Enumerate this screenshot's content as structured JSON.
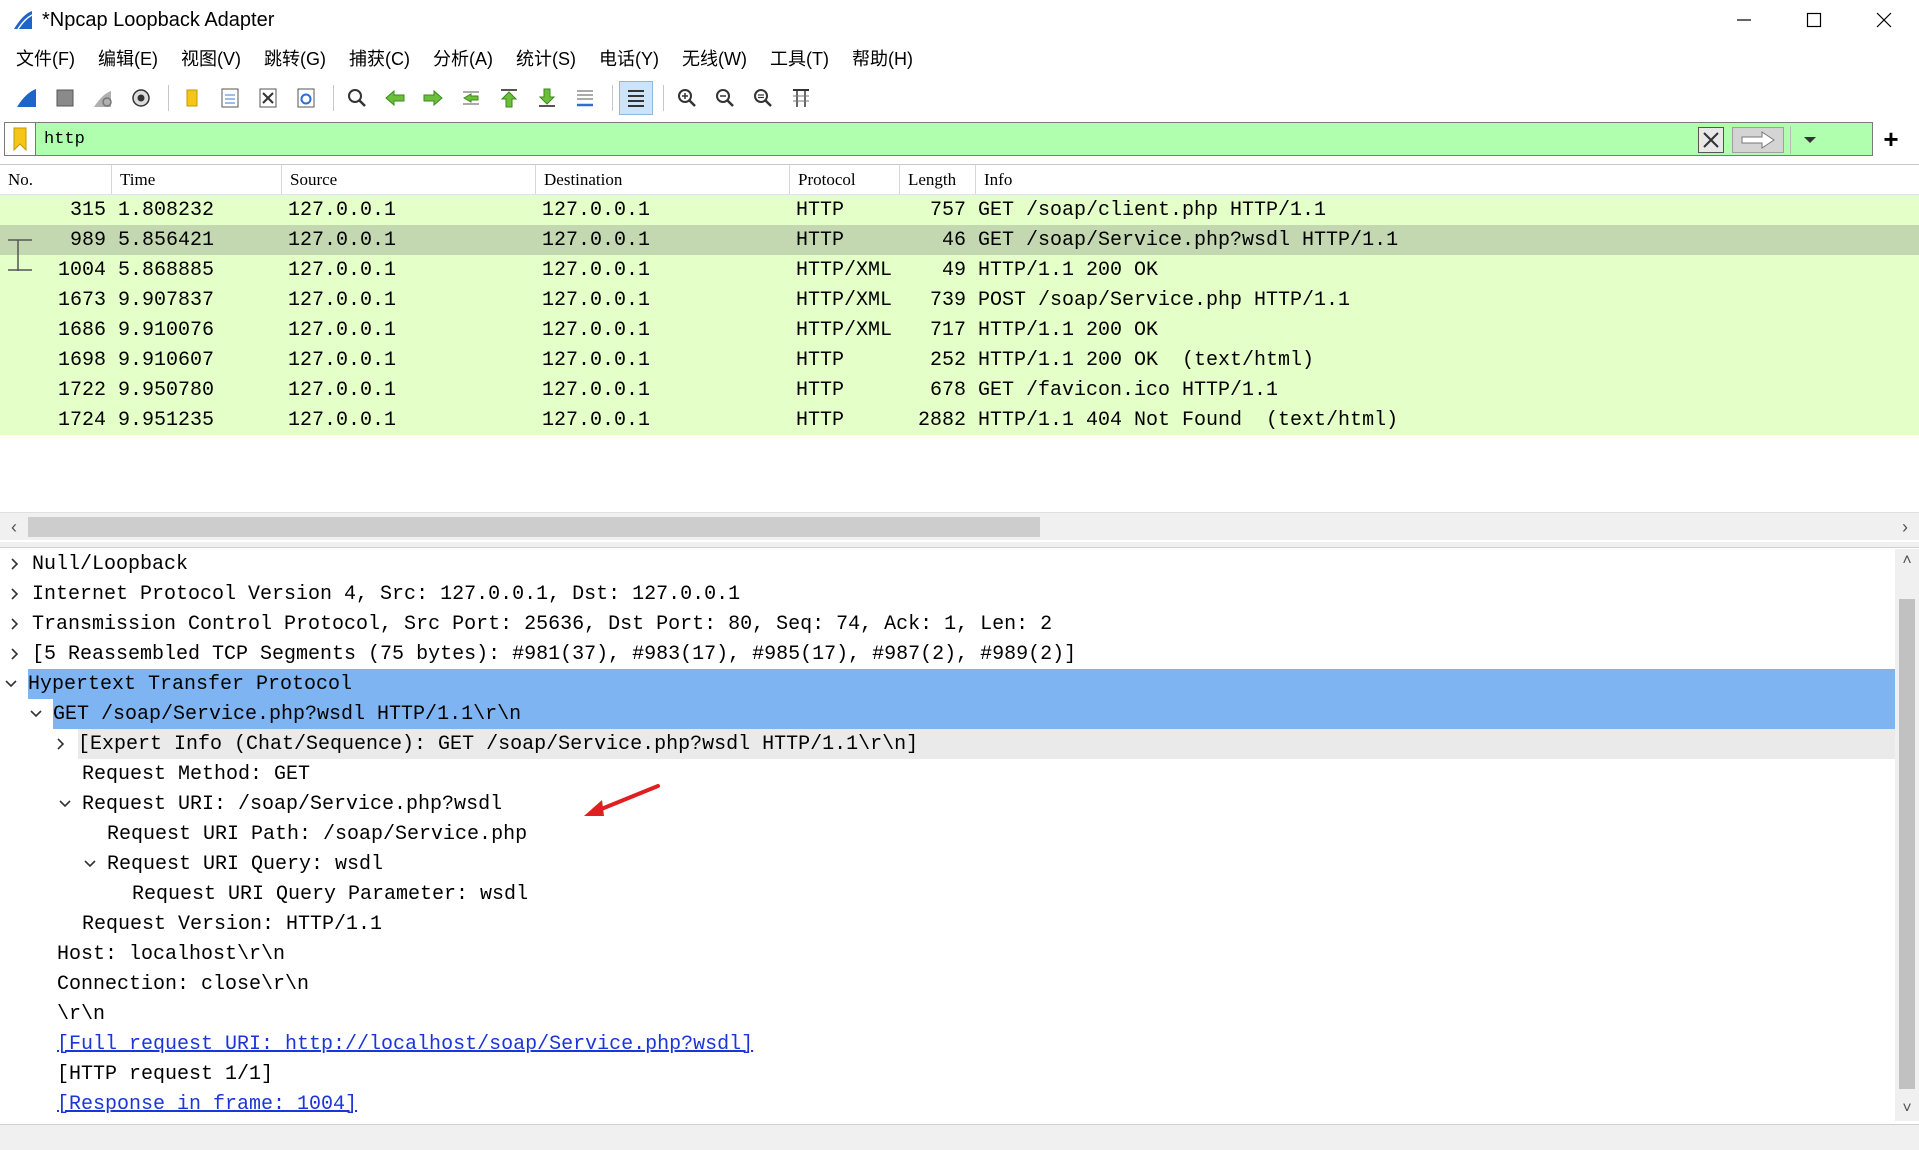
{
  "window": {
    "title": "*Npcap Loopback Adapter",
    "minimize": "—",
    "maximize": "☐",
    "close": "✕"
  },
  "menu": [
    "文件(F)",
    "编辑(E)",
    "视图(V)",
    "跳转(G)",
    "捕获(C)",
    "分析(A)",
    "统计(S)",
    "电话(Y)",
    "无线(W)",
    "工具(T)",
    "帮助(H)"
  ],
  "filter": {
    "value": "http",
    "add_label": "+"
  },
  "packet_list": {
    "columns": [
      "No.",
      "Time",
      "Source",
      "Destination",
      "Protocol",
      "Length",
      "Info"
    ],
    "rows": [
      {
        "no": "315",
        "time": "1.808232",
        "src": "127.0.0.1",
        "dst": "127.0.0.1",
        "proto": "HTTP",
        "len": "757",
        "info": "GET /soap/client.php HTTP/1.1"
      },
      {
        "no": "989",
        "time": "5.856421",
        "src": "127.0.0.1",
        "dst": "127.0.0.1",
        "proto": "HTTP",
        "len": "46",
        "info": "GET /soap/Service.php?wsdl HTTP/1.1"
      },
      {
        "no": "1004",
        "time": "5.868885",
        "src": "127.0.0.1",
        "dst": "127.0.0.1",
        "proto": "HTTP/XML",
        "len": "49",
        "info": "HTTP/1.1 200 OK"
      },
      {
        "no": "1673",
        "time": "9.907837",
        "src": "127.0.0.1",
        "dst": "127.0.0.1",
        "proto": "HTTP/XML",
        "len": "739",
        "info": "POST /soap/Service.php HTTP/1.1"
      },
      {
        "no": "1686",
        "time": "9.910076",
        "src": "127.0.0.1",
        "dst": "127.0.0.1",
        "proto": "HTTP/XML",
        "len": "717",
        "info": "HTTP/1.1 200 OK"
      },
      {
        "no": "1698",
        "time": "9.910607",
        "src": "127.0.0.1",
        "dst": "127.0.0.1",
        "proto": "HTTP",
        "len": "252",
        "info": "HTTP/1.1 200 OK  (text/html)"
      },
      {
        "no": "1722",
        "time": "9.950780",
        "src": "127.0.0.1",
        "dst": "127.0.0.1",
        "proto": "HTTP",
        "len": "678",
        "info": "GET /favicon.ico HTTP/1.1"
      },
      {
        "no": "1724",
        "time": "9.951235",
        "src": "127.0.0.1",
        "dst": "127.0.0.1",
        "proto": "HTTP",
        "len": "2882",
        "info": "HTTP/1.1 404 Not Found  (text/html)"
      }
    ],
    "selected_index": 1,
    "row_color": "#e4ffc7",
    "selected_color": "#c3d8b0"
  },
  "details": [
    {
      "level": 0,
      "toggle": "collapsed",
      "text": "Null/Loopback"
    },
    {
      "level": 0,
      "toggle": "collapsed",
      "text": "Internet Protocol Version 4, Src: 127.0.0.1, Dst: 127.0.0.1"
    },
    {
      "level": 0,
      "toggle": "collapsed",
      "text": "Transmission Control Protocol, Src Port: 25636, Dst Port: 80, Seq: 74, Ack: 1, Len: 2"
    },
    {
      "level": 0,
      "toggle": "collapsed",
      "text": "[5 Reassembled TCP Segments (75 bytes): #981(37), #983(17), #985(17), #987(2), #989(2)]"
    },
    {
      "level": 0,
      "toggle": "expanded",
      "text": "Hypertext Transfer Protocol",
      "highlight": "strong"
    },
    {
      "level": 1,
      "toggle": "expanded",
      "text": "GET /soap/Service.php?wsdl HTTP/1.1\\r\\n",
      "highlight": "sub"
    },
    {
      "level": 2,
      "toggle": "collapsed",
      "text": "[Expert Info (Chat/Sequence): GET /soap/Service.php?wsdl HTTP/1.1\\r\\n]",
      "highlight": "light"
    },
    {
      "level": 2,
      "toggle": "none",
      "text": "Request Method: GET"
    },
    {
      "level": 2,
      "toggle": "expanded",
      "text": "Request URI: /soap/Service.php?wsdl"
    },
    {
      "level": 3,
      "toggle": "none",
      "text": "Request URI Path: /soap/Service.php"
    },
    {
      "level": 3,
      "toggle": "expanded",
      "text": "Request URI Query: wsdl"
    },
    {
      "level": 4,
      "toggle": "none",
      "text": "Request URI Query Parameter: wsdl"
    },
    {
      "level": 2,
      "toggle": "none",
      "text": "Request Version: HTTP/1.1"
    },
    {
      "level": 1,
      "toggle": "none",
      "text": "Host: localhost\\r\\n"
    },
    {
      "level": 1,
      "toggle": "none",
      "text": "Connection: close\\r\\n"
    },
    {
      "level": 1,
      "toggle": "none",
      "text": "\\r\\n"
    },
    {
      "level": 1,
      "toggle": "none",
      "text": "[Full request URI: http://localhost/soap/Service.php?wsdl]",
      "link": true
    },
    {
      "level": 1,
      "toggle": "none",
      "text": "[HTTP request 1/1]"
    },
    {
      "level": 1,
      "toggle": "none",
      "text": "[Response in frame: 1004]",
      "link": true
    }
  ],
  "colors": {
    "filter_bg": "#afffaf",
    "highlight_strong": "#7fb4f2",
    "link": "#1a35d8",
    "annotation_arrow": "#e02020"
  }
}
